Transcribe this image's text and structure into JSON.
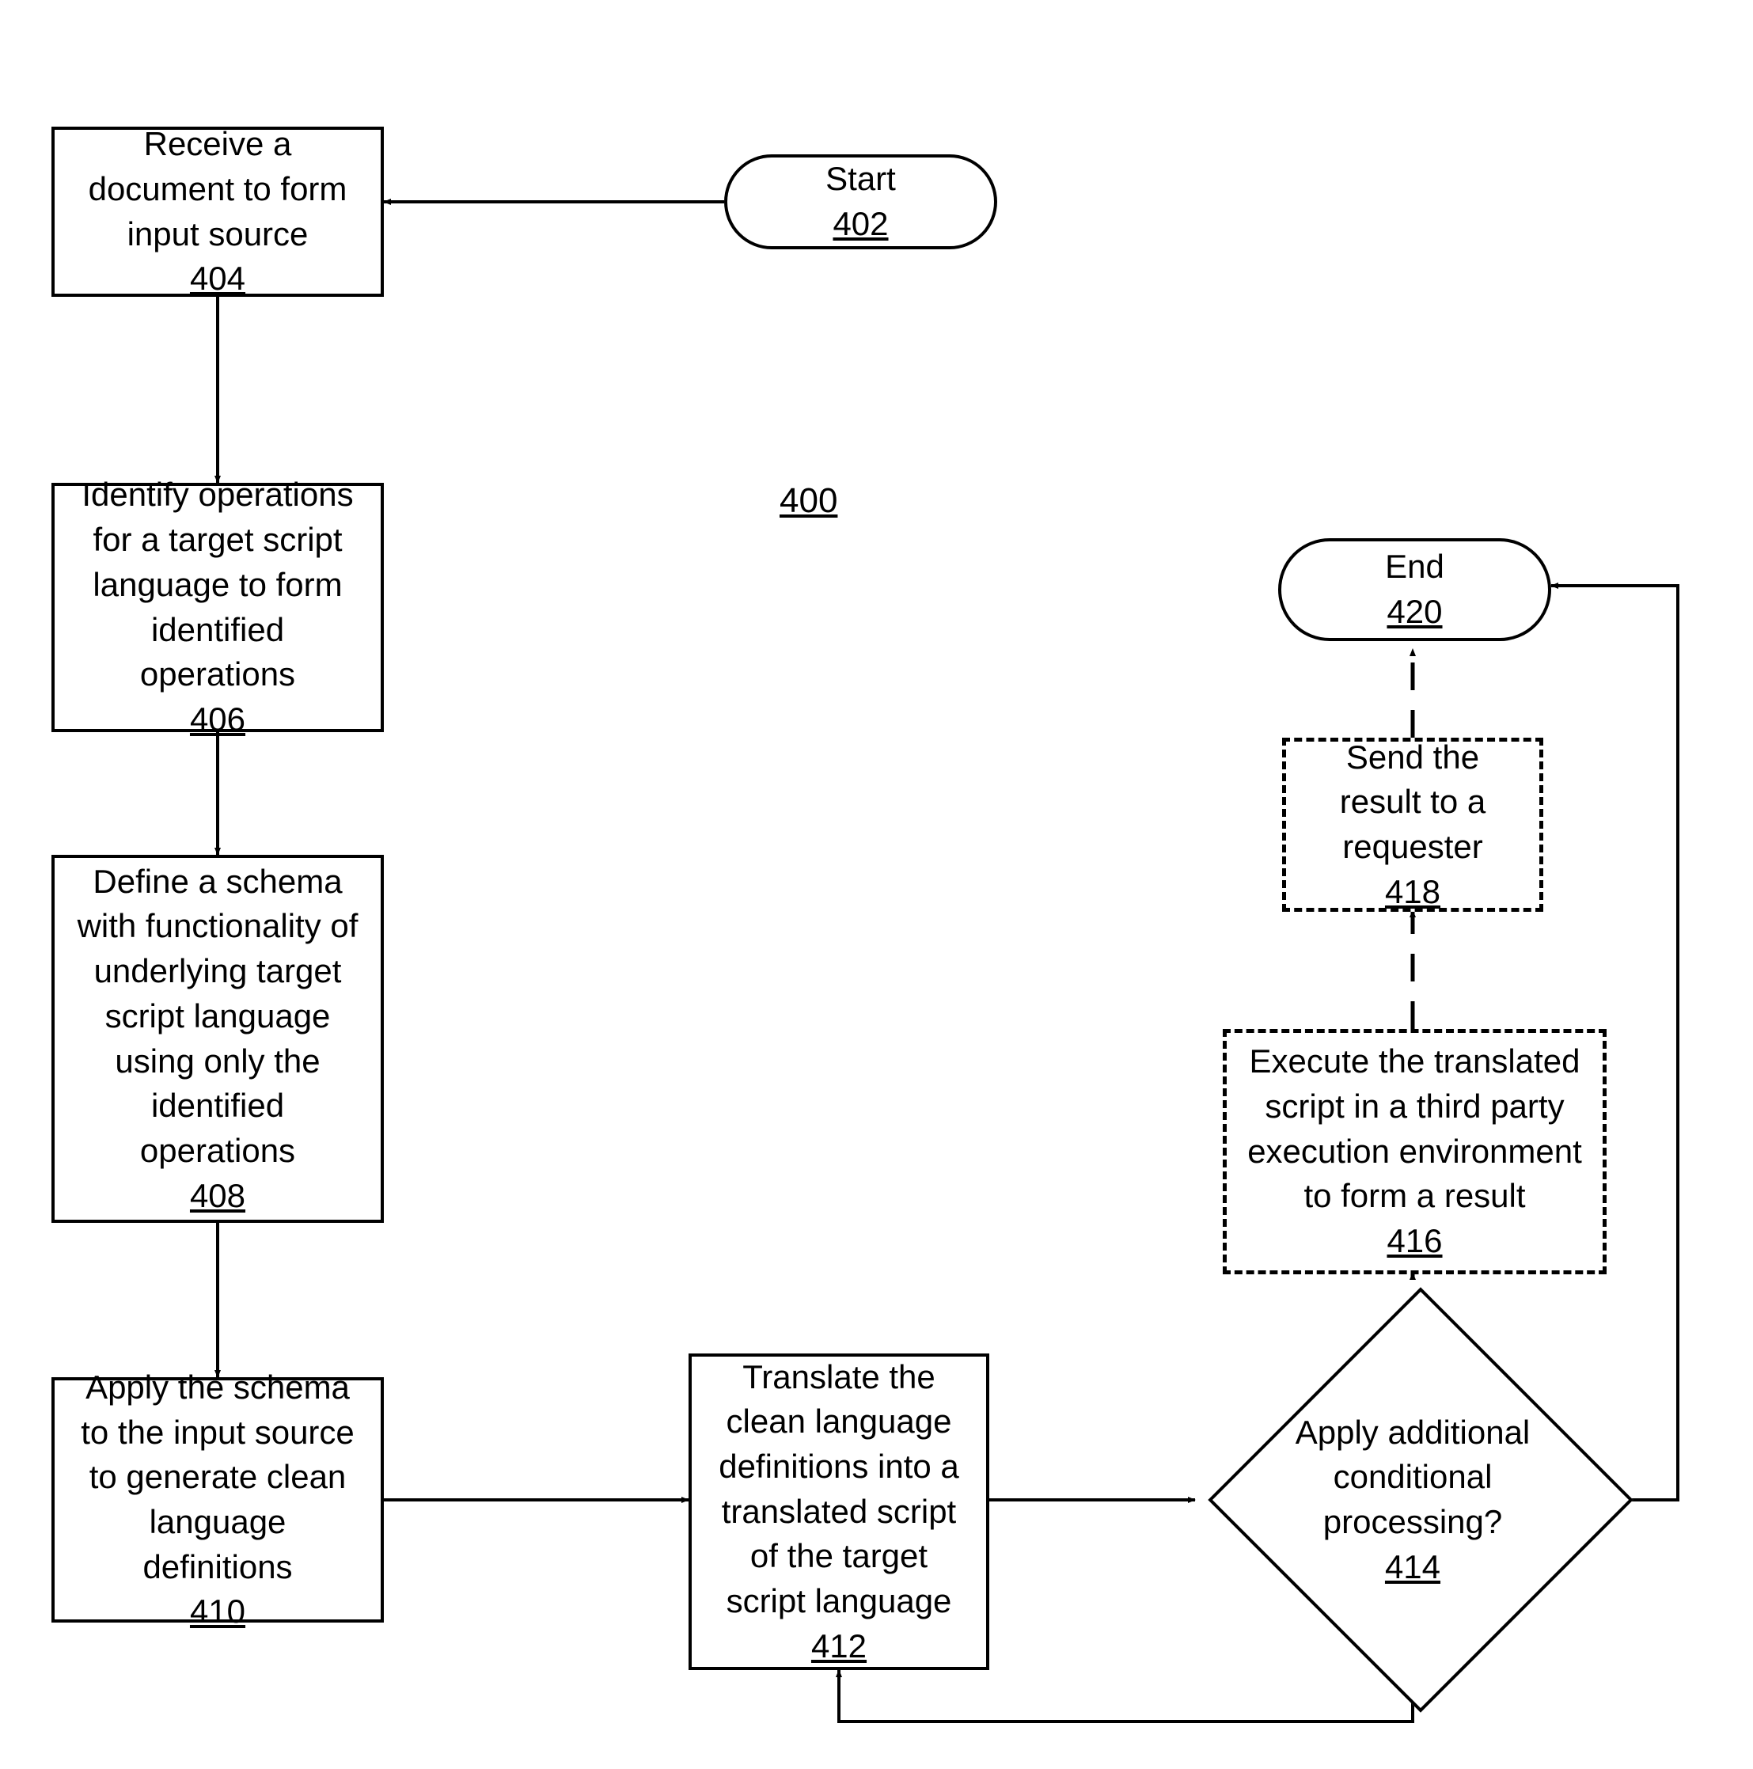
{
  "figure_ref": "400",
  "nodes": {
    "start": {
      "label": "Start",
      "ref": "402"
    },
    "receive": {
      "label": "Receive a document to form input source",
      "ref": "404"
    },
    "identify": {
      "label": "Identify operations for a target script language to form identified operations",
      "ref": "406"
    },
    "define": {
      "label": "Define a schema with functionality of underlying target script language using only the identified operations",
      "ref": "408"
    },
    "apply": {
      "label": "Apply the schema to the input source to generate clean language definitions",
      "ref": "410"
    },
    "translate": {
      "label": "Translate the clean language definitions into a translated script of the target script language",
      "ref": "412"
    },
    "decision": {
      "label": "Apply additional conditional processing?",
      "ref": "414"
    },
    "execute": {
      "label": "Execute the translated script in a third party execution environment to form a result",
      "ref": "416"
    },
    "send": {
      "label": "Send the result to a requester",
      "ref": "418"
    },
    "end": {
      "label": "End",
      "ref": "420"
    }
  }
}
